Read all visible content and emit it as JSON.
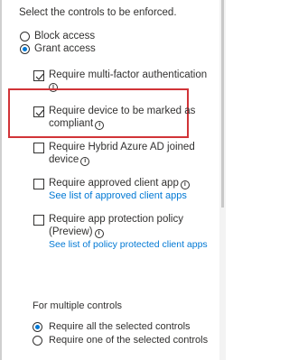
{
  "header": {
    "instruction": "Select the controls to be enforced."
  },
  "access": {
    "block_label": "Block access",
    "grant_label": "Grant access",
    "selected": "grant"
  },
  "controls": [
    {
      "label_line1": "Require multi-factor authentication",
      "label_line2": "",
      "link": "",
      "checked": true
    },
    {
      "label_line1": "Require device to be marked as",
      "label_line2": "compliant",
      "link": "",
      "checked": true
    },
    {
      "label_line1": "Require Hybrid Azure AD joined",
      "label_line2": "device",
      "link": "",
      "checked": false
    },
    {
      "label_line1": "Require approved client app",
      "label_line2": "",
      "link": "See list of approved client apps",
      "checked": false
    },
    {
      "label_line1": "Require app protection policy",
      "label_line2": "(Preview)",
      "link": "See list of policy protected client apps",
      "checked": false
    }
  ],
  "multiple": {
    "heading": "For multiple controls",
    "all_label": "Require all the selected controls",
    "one_label": "Require one of the selected controls",
    "selected": "all"
  },
  "colors": {
    "accent": "#0078d4",
    "highlight": "#d13438",
    "text": "#323130"
  }
}
